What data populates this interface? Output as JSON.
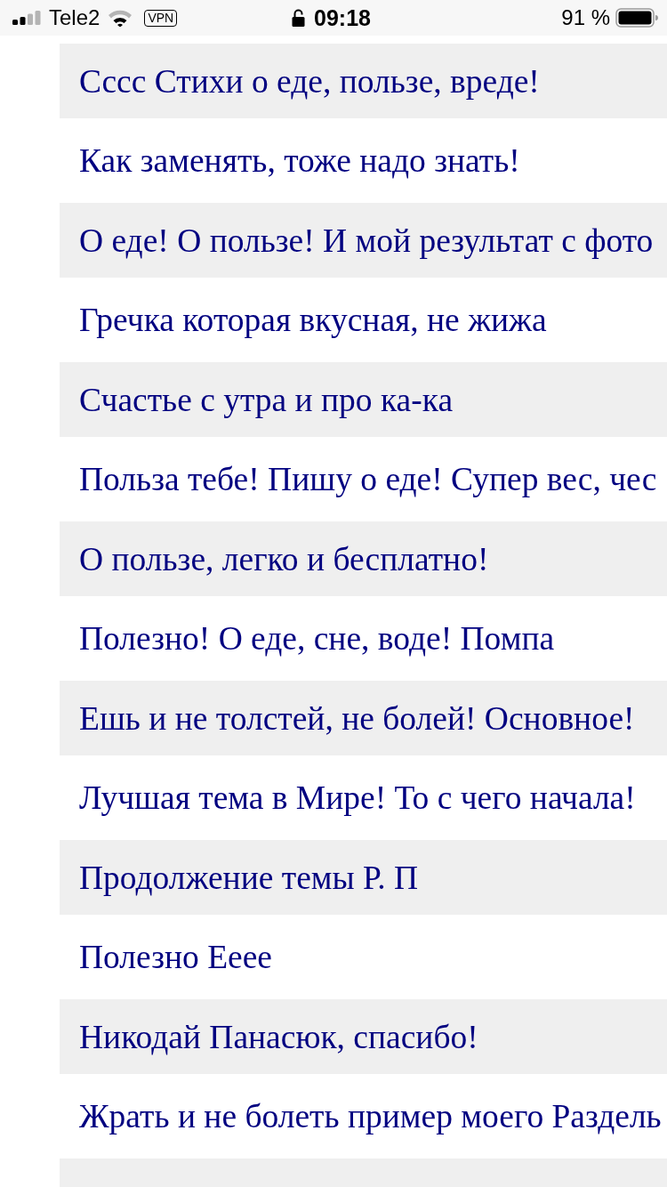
{
  "status_bar": {
    "carrier": "Tele2",
    "vpn": "VPN",
    "time": "09:18",
    "battery": "91 %"
  },
  "topics": [
    {
      "kind": "entry",
      "title": "Сссс Стихи о еде, пользе, вреде!"
    },
    {
      "kind": "entry",
      "title": "Как заменять, тоже надо знать!"
    },
    {
      "kind": "entry",
      "title": "О еде! О пользе! И мой результат с фото"
    },
    {
      "kind": "entry",
      "title": "Гречка которая вкусная, не жижа"
    },
    {
      "kind": "entry",
      "title": "Счастье с утра и про ка-ка"
    },
    {
      "kind": "entry",
      "title": "Польза тебе! Пишу о еде! Супер вес, чес"
    },
    {
      "kind": "entry",
      "title": "О пользе, легко и бесплатно!"
    },
    {
      "kind": "entry",
      "title": "Полезно! О еде, сне, воде! Помпа"
    },
    {
      "kind": "entry",
      "title": "Ешь и не толстей, не болей! Основное!"
    },
    {
      "kind": "entry",
      "title": "Лучшая тема в Мире! То с чего начала!"
    },
    {
      "kind": "entry",
      "title": "Продолжение темы Р. П"
    },
    {
      "kind": "entry",
      "title": "Полезно Ееее"
    },
    {
      "kind": "entry",
      "title": "Никодай Панасюк, спасибо!"
    },
    {
      "kind": "entry",
      "title": "Жрать и не болеть пример моего Раздель"
    },
    {
      "kind": "cut"
    }
  ]
}
